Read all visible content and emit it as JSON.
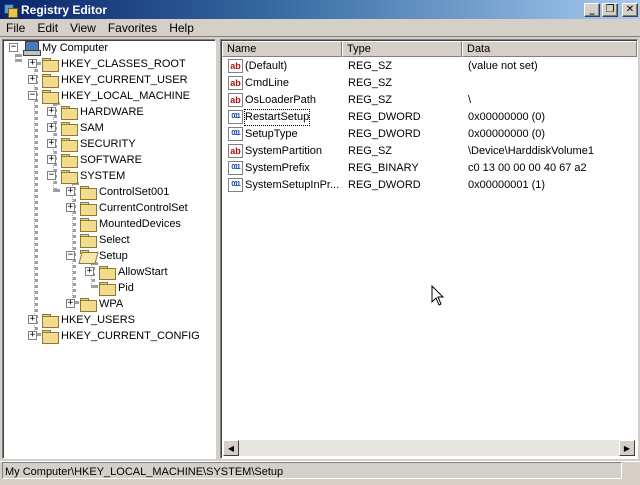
{
  "window": {
    "title": "Registry Editor",
    "buttons": {
      "minimize": "_",
      "restore": "❐",
      "close": "✕"
    }
  },
  "menu": [
    "File",
    "Edit",
    "View",
    "Favorites",
    "Help"
  ],
  "tree": {
    "root": "My Computer",
    "hives": {
      "classes_root": "HKEY_CLASSES_ROOT",
      "current_user": "HKEY_CURRENT_USER",
      "local_machine": "HKEY_LOCAL_MACHINE",
      "users": "HKEY_USERS",
      "current_config": "HKEY_CURRENT_CONFIG"
    },
    "local_machine_children": [
      "HARDWARE",
      "SAM",
      "SECURITY",
      "SOFTWARE",
      "SYSTEM"
    ],
    "system_children": [
      "ControlSet001",
      "CurrentControlSet",
      "MountedDevices",
      "Select",
      "Setup",
      "WPA"
    ],
    "setup_children": [
      "AllowStart",
      "Pid"
    ]
  },
  "list": {
    "columns": [
      "Name",
      "Type",
      "Data"
    ],
    "rows": [
      {
        "icon": "ab",
        "name": "(Default)",
        "type": "REG_SZ",
        "data": "(value not set)"
      },
      {
        "icon": "ab",
        "name": "CmdLine",
        "type": "REG_SZ",
        "data": ""
      },
      {
        "icon": "ab",
        "name": "OsLoaderPath",
        "type": "REG_SZ",
        "data": "\\"
      },
      {
        "icon": "011",
        "name": "RestartSetup",
        "type": "REG_DWORD",
        "data": "0x00000000 (0)"
      },
      {
        "icon": "011",
        "name": "SetupType",
        "type": "REG_DWORD",
        "data": "0x00000000 (0)"
      },
      {
        "icon": "ab",
        "name": "SystemPartition",
        "type": "REG_SZ",
        "data": "\\Device\\HarddiskVolume1"
      },
      {
        "icon": "011",
        "name": "SystemPrefix",
        "type": "REG_BINARY",
        "data": "c0 13 00 00 00 40 67 a2"
      },
      {
        "icon": "011",
        "name": "SystemSetupInPr...",
        "type": "REG_DWORD",
        "data": "0x00000001 (1)"
      }
    ]
  },
  "scroll": {
    "left": "◀",
    "right": "▶"
  },
  "status": "My Computer\\HKEY_LOCAL_MACHINE\\SYSTEM\\Setup"
}
